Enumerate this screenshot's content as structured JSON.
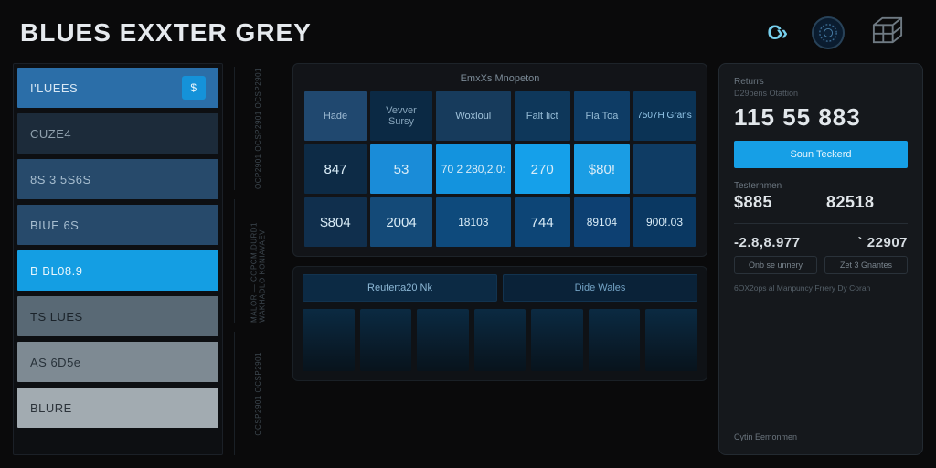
{
  "header": {
    "title": "BLUES EXXTER GREY"
  },
  "sidebar": {
    "items": [
      {
        "label": "I'LUEES",
        "badge": "$"
      },
      {
        "label": "CUZE4"
      },
      {
        "label": "8S 3 5S6S"
      },
      {
        "label": "BIUE 6S"
      },
      {
        "label": "B BL08.9"
      },
      {
        "label": "TS LUES"
      },
      {
        "label": "AS 6D5e"
      },
      {
        "label": "BLURE"
      }
    ]
  },
  "vstrip": {
    "a": "OCP2901  OCSP2901  OCSP2901",
    "b": "MALOR — COPCM.DURD1  WAKHADLO  KONIAVAEV",
    "c": "OCSP2901  OCSP2901"
  },
  "table": {
    "title": "EmxXs Mnopeton",
    "headers": [
      "Hade",
      "Vevver Sursy",
      "Woxloul",
      "Falt lict",
      "Fla Toa",
      "7507H Grans"
    ],
    "rows": [
      [
        "847",
        "53",
        "70 2 280,2.0:",
        "270",
        "$80!"
      ],
      [
        "$804",
        "2004",
        "18103",
        "744",
        "89104",
        "900!.03"
      ]
    ]
  },
  "sub": {
    "tabs": [
      "Reuterta20 Nk",
      "Dide Wales"
    ]
  },
  "right": {
    "label": "Returrs",
    "sublabel": "D29bens Otattion",
    "big": "115 55 883",
    "button": "Soun Teckerd",
    "sec1_label": "Testernmen",
    "sec1_a": "$885",
    "sec1_b": "82518",
    "row2_a": "-2.8,8.977",
    "row2_b": "` 22907",
    "chip_a": "Onb se unnery",
    "chip_b": "Zet 3 Gnantes",
    "foot": "6OX2ops al Manpuncy Frrery Dy Coran",
    "corner": "Cytin Eemonmen"
  },
  "colors": {
    "accent": "#149ee3",
    "panel": "#121418",
    "bg": "#0a0a0b"
  }
}
